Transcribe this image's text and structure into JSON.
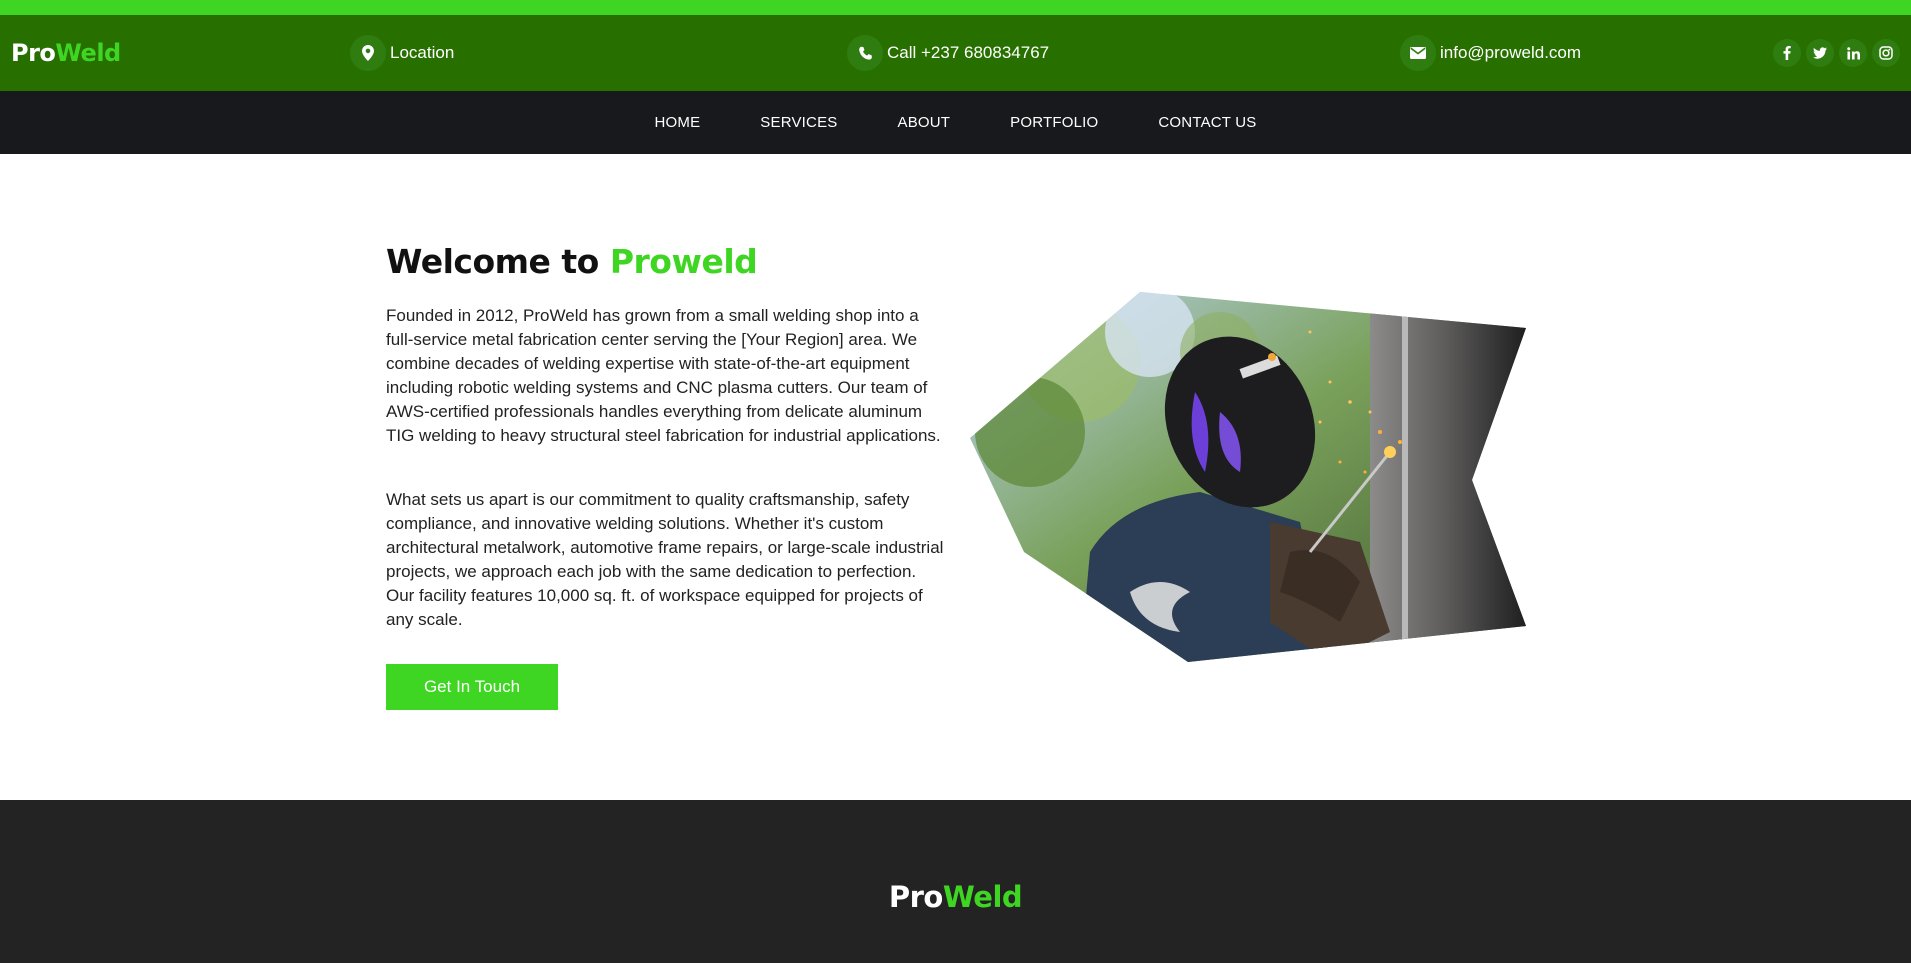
{
  "colors": {
    "accent": "#3ed622",
    "topbar_bg": "#277000",
    "navbar_bg": "#17191c",
    "footer_bg": "#232323"
  },
  "header": {
    "brand": {
      "part1": "Pro",
      "part2": "Weld"
    },
    "location": {
      "icon": "map-pin-icon",
      "text": "Location"
    },
    "phone": {
      "icon": "phone-icon",
      "text": "Call +237 680834767"
    },
    "email": {
      "icon": "envelope-icon",
      "text": "info@proweld.com"
    },
    "socials": [
      {
        "icon": "facebook-icon",
        "glyph": "f"
      },
      {
        "icon": "twitter-icon",
        "glyph": "t"
      },
      {
        "icon": "linkedin-icon",
        "glyph": "in"
      },
      {
        "icon": "instagram-icon",
        "glyph": "ig"
      }
    ]
  },
  "nav": {
    "items": [
      "HOME",
      "SERVICES",
      "ABOUT",
      "PORTFOLIO",
      "CONTACT US"
    ]
  },
  "hero": {
    "title_prefix": "Welcome to ",
    "title_accent": "Proweld",
    "paragraph_1": "Founded in 2012, ProWeld has grown from a small welding shop into a full-service metal fabrication center serving the [Your Region] area. We combine decades of welding expertise with state-of-the-art equipment including robotic welding systems and CNC plasma cutters. Our team of AWS-certified professionals handles everything from delicate aluminum TIG welding to heavy structural steel fabrication for industrial applications.",
    "paragraph_2": "What sets us apart is our commitment to quality craftsmanship, safety compliance, and innovative welding solutions. Whether it's custom architectural metalwork, automotive frame repairs, or large-scale industrial projects, we approach each job with the same dedication to perfection. Our facility features 10,000 sq. ft. of workspace equipped for projects of any scale.",
    "cta_label": "Get In Touch"
  },
  "footer": {
    "brand": {
      "part1": "Pro",
      "part2": "Weld"
    }
  }
}
